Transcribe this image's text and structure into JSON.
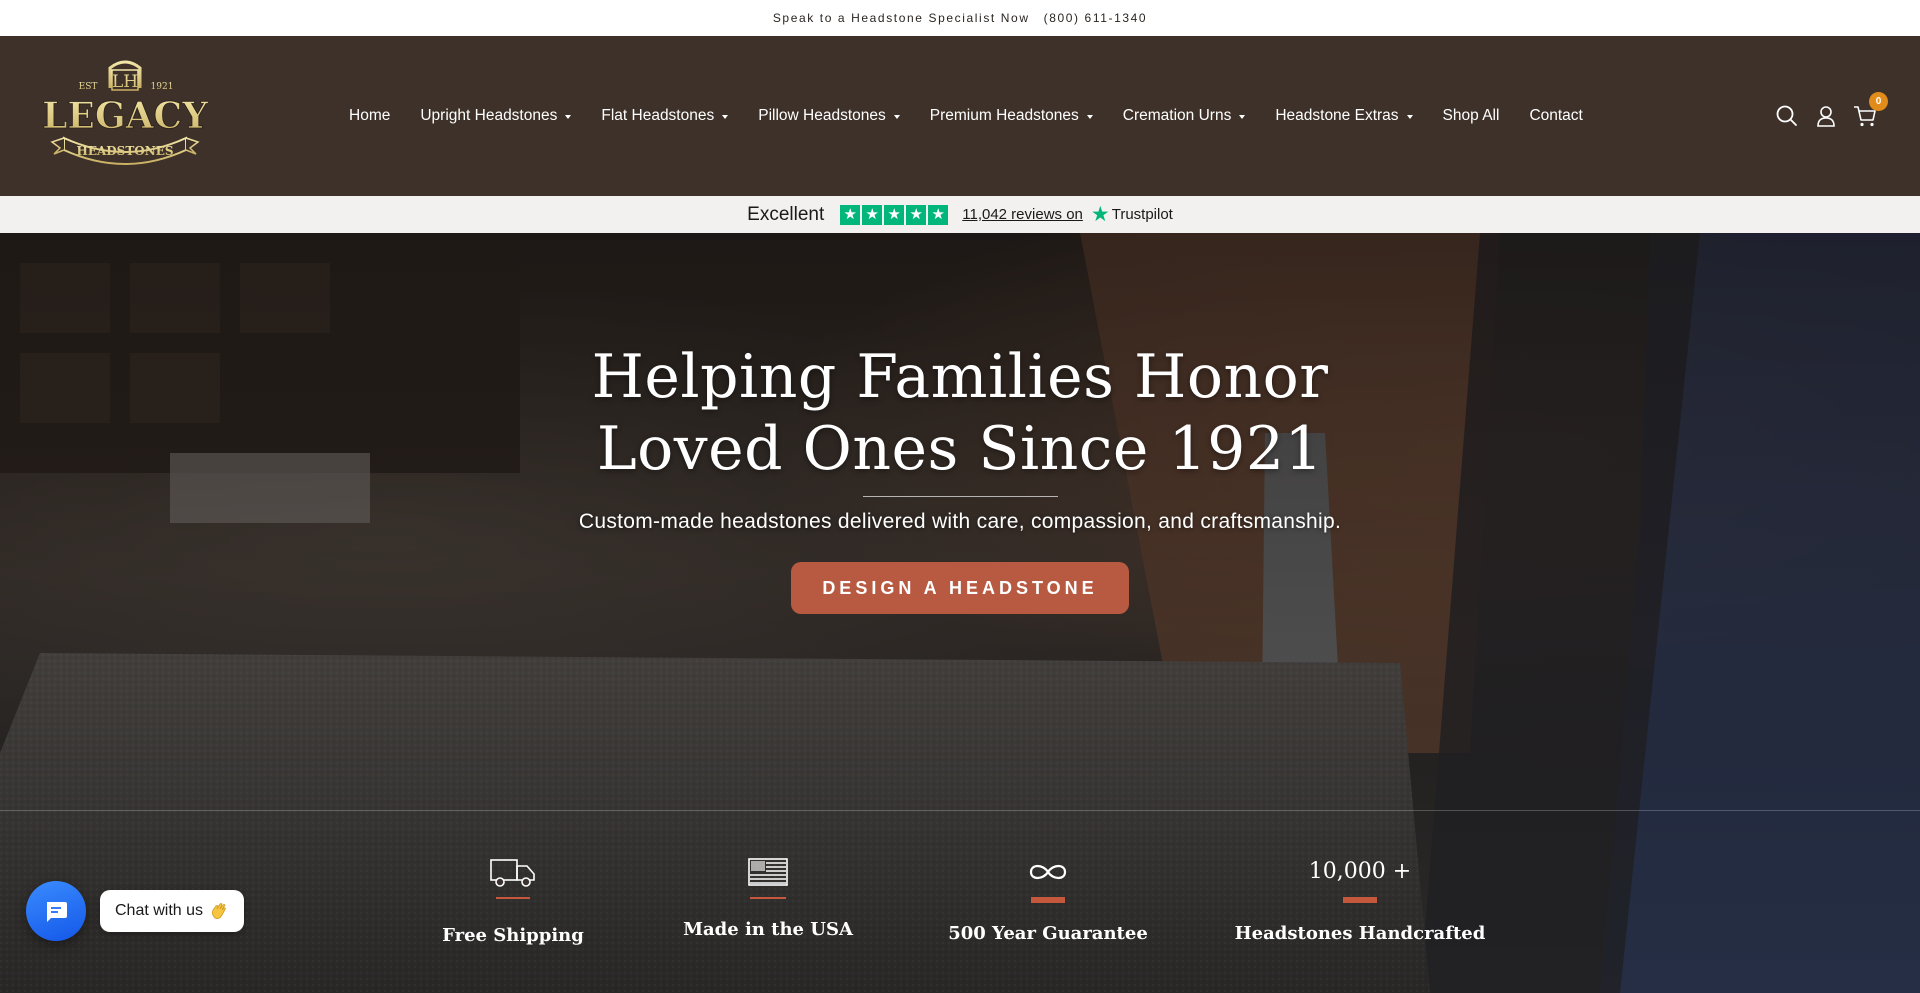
{
  "announcement": {
    "text": "Speak to a Headstone Specialist Now",
    "phone": "(800) 611-1340"
  },
  "logo": {
    "est": "EST",
    "year": "1921",
    "monogram": "LH",
    "word1": "LEGACY",
    "word2": "HEADSTONES"
  },
  "nav": {
    "items": [
      {
        "label": "Home",
        "dropdown": false
      },
      {
        "label": "Upright Headstones",
        "dropdown": true
      },
      {
        "label": "Flat Headstones",
        "dropdown": true
      },
      {
        "label": "Pillow Headstones",
        "dropdown": true
      },
      {
        "label": "Premium Headstones",
        "dropdown": true
      },
      {
        "label": "Cremation Urns",
        "dropdown": true
      },
      {
        "label": "Headstone Extras",
        "dropdown": true
      },
      {
        "label": "Shop All",
        "dropdown": false
      },
      {
        "label": "Contact",
        "dropdown": false
      }
    ]
  },
  "header_icons": {
    "search": "search-icon",
    "account": "user-icon",
    "cart": "cart-icon",
    "cart_count": "0"
  },
  "trustpilot": {
    "rating_word": "Excellent",
    "stars": 5,
    "reviews_text": "11,042 reviews on",
    "brand": "Trustpilot"
  },
  "hero": {
    "title_line1": "Helping Families Honor",
    "title_line2": "Loved Ones Since 1921",
    "subtitle": "Custom-made headstones delivered with care, compassion, and craftsmanship.",
    "cta_label": "DESIGN A HEADSTONE"
  },
  "features": [
    {
      "icon": "truck-icon",
      "label": "Free Shipping"
    },
    {
      "icon": "flag-icon",
      "label": "Made in the USA"
    },
    {
      "icon": "infinity-icon",
      "label": "500 Year Guarantee"
    },
    {
      "number": "10,000 +",
      "label": "Headstones Handcrafted"
    }
  ],
  "chat": {
    "label": "Chat with us"
  },
  "colors": {
    "header_bg": "#3d3129",
    "accent": "#b85a41",
    "trustpilot_green": "#00b67a",
    "cart_badge": "#e08b1a",
    "chat_blue": "#1f6bff"
  }
}
